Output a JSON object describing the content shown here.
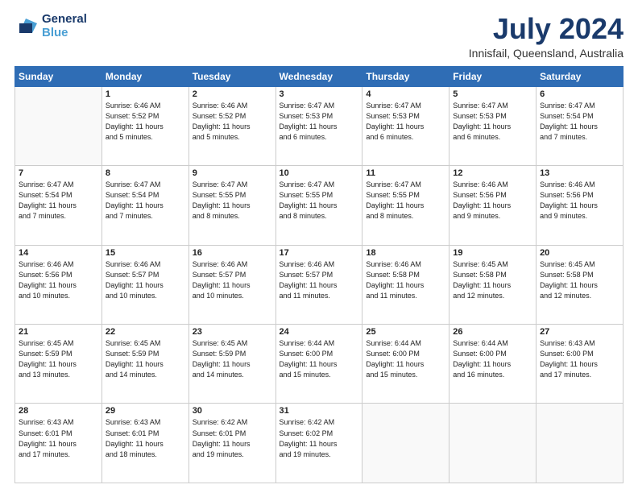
{
  "logo": {
    "line1": "General",
    "line2": "Blue"
  },
  "title": "July 2024",
  "subtitle": "Innisfail, Queensland, Australia",
  "days_of_week": [
    "Sunday",
    "Monday",
    "Tuesday",
    "Wednesday",
    "Thursday",
    "Friday",
    "Saturday"
  ],
  "weeks": [
    [
      {
        "day": "",
        "info": ""
      },
      {
        "day": "1",
        "info": "Sunrise: 6:46 AM\nSunset: 5:52 PM\nDaylight: 11 hours\nand 5 minutes."
      },
      {
        "day": "2",
        "info": "Sunrise: 6:46 AM\nSunset: 5:52 PM\nDaylight: 11 hours\nand 5 minutes."
      },
      {
        "day": "3",
        "info": "Sunrise: 6:47 AM\nSunset: 5:53 PM\nDaylight: 11 hours\nand 6 minutes."
      },
      {
        "day": "4",
        "info": "Sunrise: 6:47 AM\nSunset: 5:53 PM\nDaylight: 11 hours\nand 6 minutes."
      },
      {
        "day": "5",
        "info": "Sunrise: 6:47 AM\nSunset: 5:53 PM\nDaylight: 11 hours\nand 6 minutes."
      },
      {
        "day": "6",
        "info": "Sunrise: 6:47 AM\nSunset: 5:54 PM\nDaylight: 11 hours\nand 7 minutes."
      }
    ],
    [
      {
        "day": "7",
        "info": "Sunrise: 6:47 AM\nSunset: 5:54 PM\nDaylight: 11 hours\nand 7 minutes."
      },
      {
        "day": "8",
        "info": "Sunrise: 6:47 AM\nSunset: 5:54 PM\nDaylight: 11 hours\nand 7 minutes."
      },
      {
        "day": "9",
        "info": "Sunrise: 6:47 AM\nSunset: 5:55 PM\nDaylight: 11 hours\nand 8 minutes."
      },
      {
        "day": "10",
        "info": "Sunrise: 6:47 AM\nSunset: 5:55 PM\nDaylight: 11 hours\nand 8 minutes."
      },
      {
        "day": "11",
        "info": "Sunrise: 6:47 AM\nSunset: 5:55 PM\nDaylight: 11 hours\nand 8 minutes."
      },
      {
        "day": "12",
        "info": "Sunrise: 6:46 AM\nSunset: 5:56 PM\nDaylight: 11 hours\nand 9 minutes."
      },
      {
        "day": "13",
        "info": "Sunrise: 6:46 AM\nSunset: 5:56 PM\nDaylight: 11 hours\nand 9 minutes."
      }
    ],
    [
      {
        "day": "14",
        "info": "Sunrise: 6:46 AM\nSunset: 5:56 PM\nDaylight: 11 hours\nand 10 minutes."
      },
      {
        "day": "15",
        "info": "Sunrise: 6:46 AM\nSunset: 5:57 PM\nDaylight: 11 hours\nand 10 minutes."
      },
      {
        "day": "16",
        "info": "Sunrise: 6:46 AM\nSunset: 5:57 PM\nDaylight: 11 hours\nand 10 minutes."
      },
      {
        "day": "17",
        "info": "Sunrise: 6:46 AM\nSunset: 5:57 PM\nDaylight: 11 hours\nand 11 minutes."
      },
      {
        "day": "18",
        "info": "Sunrise: 6:46 AM\nSunset: 5:58 PM\nDaylight: 11 hours\nand 11 minutes."
      },
      {
        "day": "19",
        "info": "Sunrise: 6:45 AM\nSunset: 5:58 PM\nDaylight: 11 hours\nand 12 minutes."
      },
      {
        "day": "20",
        "info": "Sunrise: 6:45 AM\nSunset: 5:58 PM\nDaylight: 11 hours\nand 12 minutes."
      }
    ],
    [
      {
        "day": "21",
        "info": "Sunrise: 6:45 AM\nSunset: 5:59 PM\nDaylight: 11 hours\nand 13 minutes."
      },
      {
        "day": "22",
        "info": "Sunrise: 6:45 AM\nSunset: 5:59 PM\nDaylight: 11 hours\nand 14 minutes."
      },
      {
        "day": "23",
        "info": "Sunrise: 6:45 AM\nSunset: 5:59 PM\nDaylight: 11 hours\nand 14 minutes."
      },
      {
        "day": "24",
        "info": "Sunrise: 6:44 AM\nSunset: 6:00 PM\nDaylight: 11 hours\nand 15 minutes."
      },
      {
        "day": "25",
        "info": "Sunrise: 6:44 AM\nSunset: 6:00 PM\nDaylight: 11 hours\nand 15 minutes."
      },
      {
        "day": "26",
        "info": "Sunrise: 6:44 AM\nSunset: 6:00 PM\nDaylight: 11 hours\nand 16 minutes."
      },
      {
        "day": "27",
        "info": "Sunrise: 6:43 AM\nSunset: 6:00 PM\nDaylight: 11 hours\nand 17 minutes."
      }
    ],
    [
      {
        "day": "28",
        "info": "Sunrise: 6:43 AM\nSunset: 6:01 PM\nDaylight: 11 hours\nand 17 minutes."
      },
      {
        "day": "29",
        "info": "Sunrise: 6:43 AM\nSunset: 6:01 PM\nDaylight: 11 hours\nand 18 minutes."
      },
      {
        "day": "30",
        "info": "Sunrise: 6:42 AM\nSunset: 6:01 PM\nDaylight: 11 hours\nand 19 minutes."
      },
      {
        "day": "31",
        "info": "Sunrise: 6:42 AM\nSunset: 6:02 PM\nDaylight: 11 hours\nand 19 minutes."
      },
      {
        "day": "",
        "info": ""
      },
      {
        "day": "",
        "info": ""
      },
      {
        "day": "",
        "info": ""
      }
    ]
  ]
}
